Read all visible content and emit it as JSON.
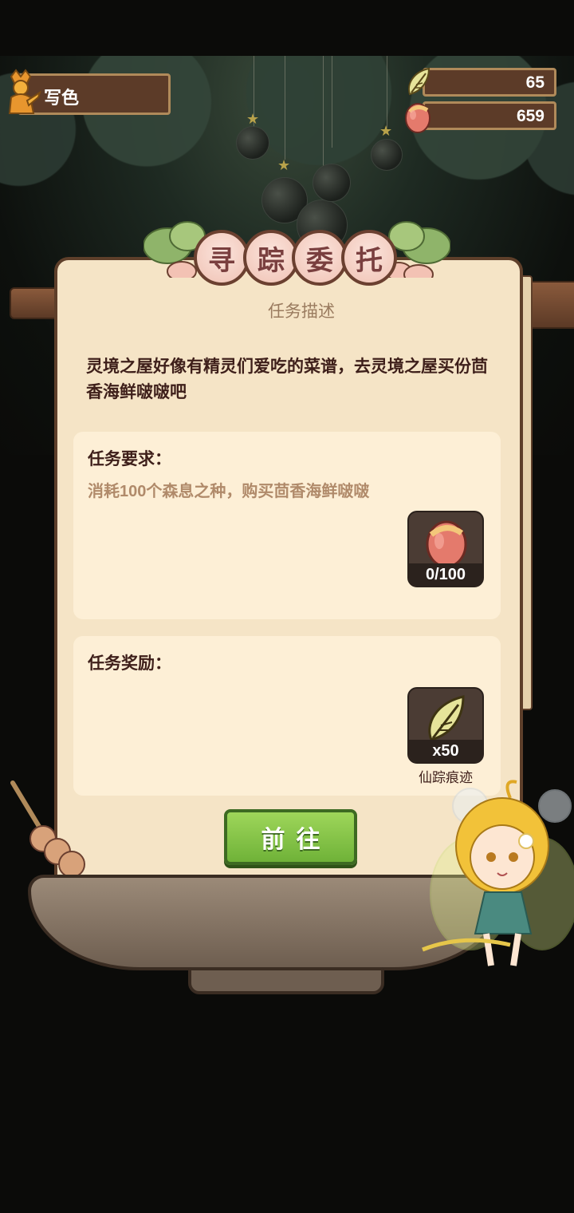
{
  "player": {
    "name": "写色",
    "avatar_icon": "golden-statue-icon"
  },
  "resources": [
    {
      "icon": "fairy-wing-icon",
      "value": "65"
    },
    {
      "icon": "seed-egg-icon",
      "value": "659"
    }
  ],
  "panel": {
    "title_chars": [
      "寻",
      "踪",
      "委",
      "托"
    ],
    "section_heading": "任务描述",
    "description": "灵境之屋好像有精灵们爱吃的菜谱，去灵境之屋买份茴香海鲜啵啵吧",
    "requirement": {
      "title": "任务要求：",
      "text": "消耗100个森息之种，购买茴香海鲜啵啵",
      "item_icon": "seed-egg-icon",
      "item_count": "0/100"
    },
    "reward": {
      "title": "任务奖励：",
      "item_icon": "fairy-wing-icon",
      "item_count": "x50",
      "item_name": "仙踪痕迹"
    },
    "go_button": "前往"
  },
  "colors": {
    "panel_bg": "#f5e4c6",
    "card_bg": "#fdefd6",
    "button_green": "#7fc046",
    "title_text": "#3e1f1a",
    "muted_text": "#b08a6a"
  }
}
